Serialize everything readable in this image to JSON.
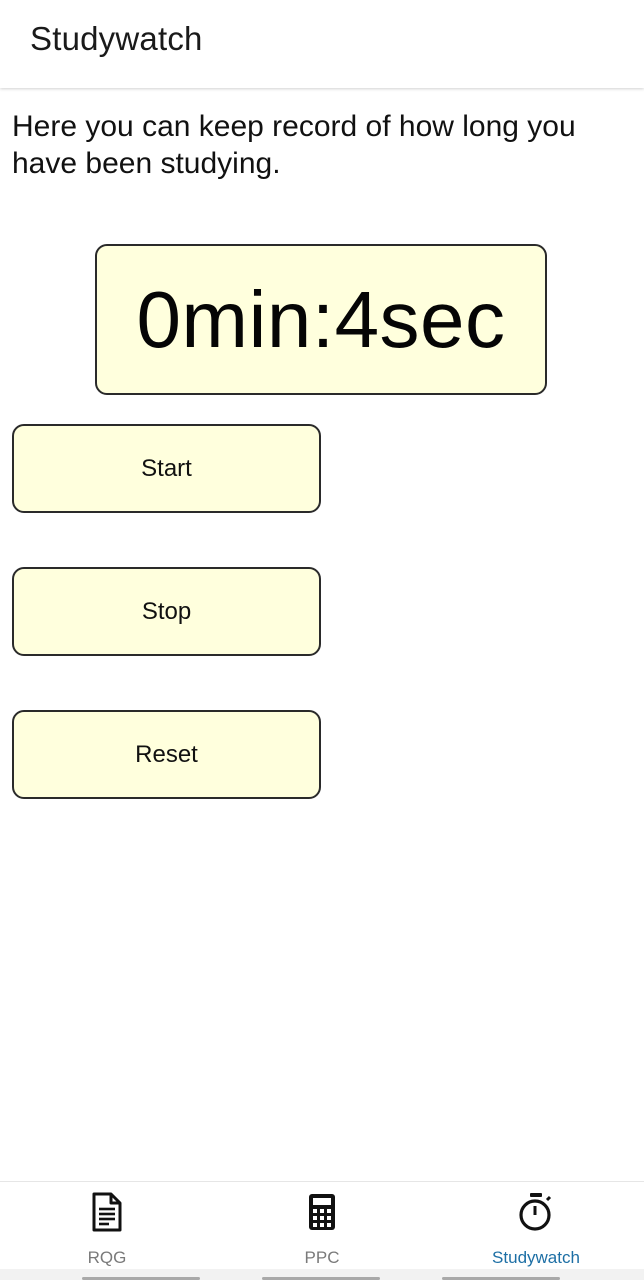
{
  "app_bar": {
    "title": "Studywatch"
  },
  "main": {
    "description": "Here you can keep record of how long you have been studying.",
    "timer": {
      "display": "0min:4sec"
    },
    "buttons": {
      "start_label": "Start",
      "stop_label": "Stop",
      "reset_label": "Reset"
    }
  },
  "bottom_nav": {
    "items": [
      {
        "label": "RQG",
        "icon": "document-icon",
        "active": false
      },
      {
        "label": "PPC",
        "icon": "calculator-icon",
        "active": false
      },
      {
        "label": "Studywatch",
        "icon": "stopwatch-icon",
        "active": true
      }
    ]
  },
  "colors": {
    "button_fill": "#ffffdd",
    "button_border": "#2a2a2a",
    "nav_active": "#1d6fa5",
    "nav_inactive": "#7a7a7a"
  }
}
